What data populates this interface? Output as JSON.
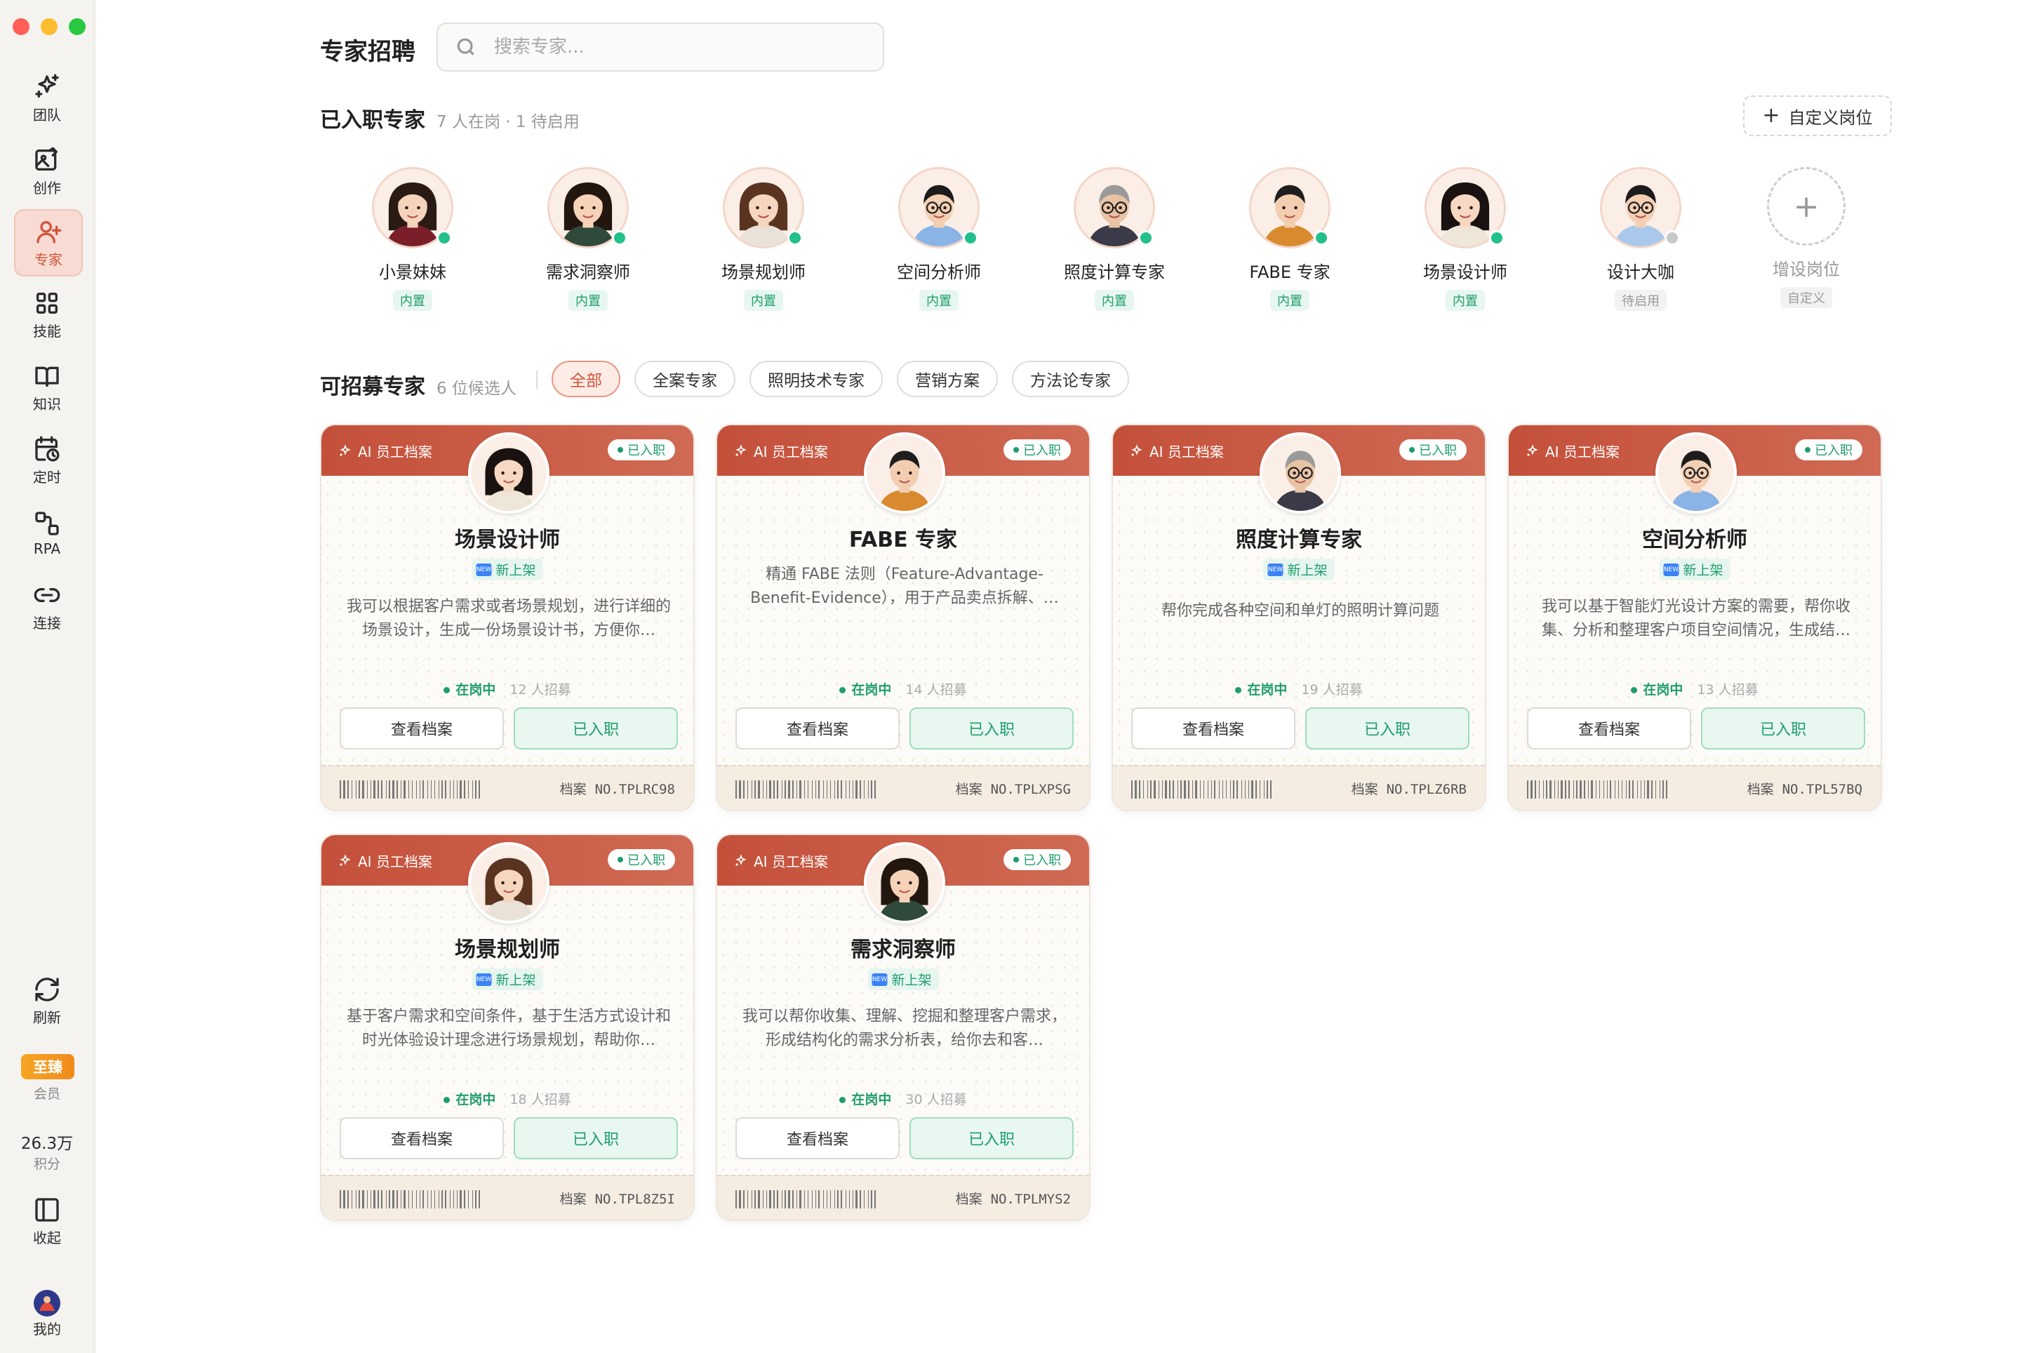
{
  "window": {
    "controls": [
      "close",
      "minimize",
      "maximize"
    ]
  },
  "sidebar": {
    "items": [
      {
        "label": "团队",
        "icon": "sparkles-icon"
      },
      {
        "label": "创作",
        "icon": "image-edit-icon"
      },
      {
        "label": "专家",
        "icon": "user-plus-icon",
        "active": true
      },
      {
        "label": "技能",
        "icon": "grid-icon"
      },
      {
        "label": "知识",
        "icon": "book-icon"
      },
      {
        "label": "定时",
        "icon": "calendar-clock-icon"
      },
      {
        "label": "RPA",
        "icon": "workflow-icon"
      },
      {
        "label": "连接",
        "icon": "link-icon"
      }
    ],
    "refresh_label": "刷新",
    "vip_badge": "至臻",
    "vip_label": "会员",
    "points_value": "26.3万",
    "points_label": "积分",
    "collapse_label": "收起",
    "me_label": "我的"
  },
  "header": {
    "title": "专家招聘",
    "search_placeholder": "搜索专家..."
  },
  "onboarded": {
    "title": "已入职专家",
    "subtitle": "7 人在岗 · 1 待启用",
    "custom_button": "自定义岗位",
    "members": [
      {
        "name": "小景妹妹",
        "tag": "内置",
        "status": "online"
      },
      {
        "name": "需求洞察师",
        "tag": "内置",
        "status": "online"
      },
      {
        "name": "场景规划师",
        "tag": "内置",
        "status": "online"
      },
      {
        "name": "空间分析师",
        "tag": "内置",
        "status": "online"
      },
      {
        "name": "照度计算专家",
        "tag": "内置",
        "status": "online"
      },
      {
        "name": "FABE 专家",
        "tag": "内置",
        "status": "online"
      },
      {
        "name": "场景设计师",
        "tag": "内置",
        "status": "online"
      },
      {
        "name": "设计大咖",
        "tag": "待启用",
        "status": "offline"
      }
    ],
    "add_slot": {
      "name": "增设岗位",
      "tag": "自定义"
    }
  },
  "recruitable": {
    "title": "可招募专家",
    "subtitle": "6 位候选人",
    "filters": [
      "全部",
      "全案专家",
      "照明技术专家",
      "营销方案",
      "方法论专家"
    ],
    "active_filter": "全部"
  },
  "cards": [
    {
      "header_label": "AI 员工档案",
      "hired_badge": "已入职",
      "name": "场景设计师",
      "new_label": "新上架",
      "new_icon": "NEW",
      "desc": "我可以根据客户需求或者场景规划，进行详细的场景设计，生成一份场景设计书，方便你…",
      "status": "在岗中",
      "count": "12 人招募",
      "view": "查看档案",
      "hire": "已入职",
      "file_label": "档案",
      "file_no": "NO.TPLRC98"
    },
    {
      "header_label": "AI 员工档案",
      "hired_badge": "已入职",
      "name": "FABE 专家",
      "new_label": "",
      "new_icon": "",
      "desc": "精通 FABE 法则（Feature-Advantage-Benefit-Evidence），用于产品卖点拆解、…",
      "status": "在岗中",
      "count": "14 人招募",
      "view": "查看档案",
      "hire": "已入职",
      "file_label": "档案",
      "file_no": "NO.TPLXPSG"
    },
    {
      "header_label": "AI 员工档案",
      "hired_badge": "已入职",
      "name": "照度计算专家",
      "new_label": "新上架",
      "new_icon": "NEW",
      "desc": "帮你完成各种空间和单灯的照明计算问题",
      "status": "在岗中",
      "count": "19 人招募",
      "view": "查看档案",
      "hire": "已入职",
      "file_label": "档案",
      "file_no": "NO.TPLZ6RB"
    },
    {
      "header_label": "AI 员工档案",
      "hired_badge": "已入职",
      "name": "空间分析师",
      "new_label": "新上架",
      "new_icon": "NEW",
      "desc": "我可以基于智能灯光设计方案的需要，帮你收集、分析和整理客户项目空间情况，生成结…",
      "status": "在岗中",
      "count": "13 人招募",
      "view": "查看档案",
      "hire": "已入职",
      "file_label": "档案",
      "file_no": "NO.TPL57BQ"
    },
    {
      "header_label": "AI 员工档案",
      "hired_badge": "已入职",
      "name": "场景规划师",
      "new_label": "新上架",
      "new_icon": "NEW",
      "desc": "基于客户需求和空间条件，基于生活方式设计和时光体验设计理念进行场景规划，帮助你…",
      "status": "在岗中",
      "count": "18 人招募",
      "view": "查看档案",
      "hire": "已入职",
      "file_label": "档案",
      "file_no": "NO.TPL8Z5I"
    },
    {
      "header_label": "AI 员工档案",
      "hired_badge": "已入职",
      "name": "需求洞察师",
      "new_label": "新上架",
      "new_icon": "NEW",
      "desc": "我可以帮你收集、理解、挖掘和整理客户需求，形成结构化的需求分析表，给你去和客…",
      "status": "在岗中",
      "count": "30 人招募",
      "view": "查看档案",
      "hire": "已入职",
      "file_label": "档案",
      "file_no": "NO.TPLMYS2"
    }
  ],
  "colors": {
    "accent": "#d2553c",
    "card_header": "#c4503a",
    "online": "#22c08a",
    "vip": "#f6a623"
  }
}
